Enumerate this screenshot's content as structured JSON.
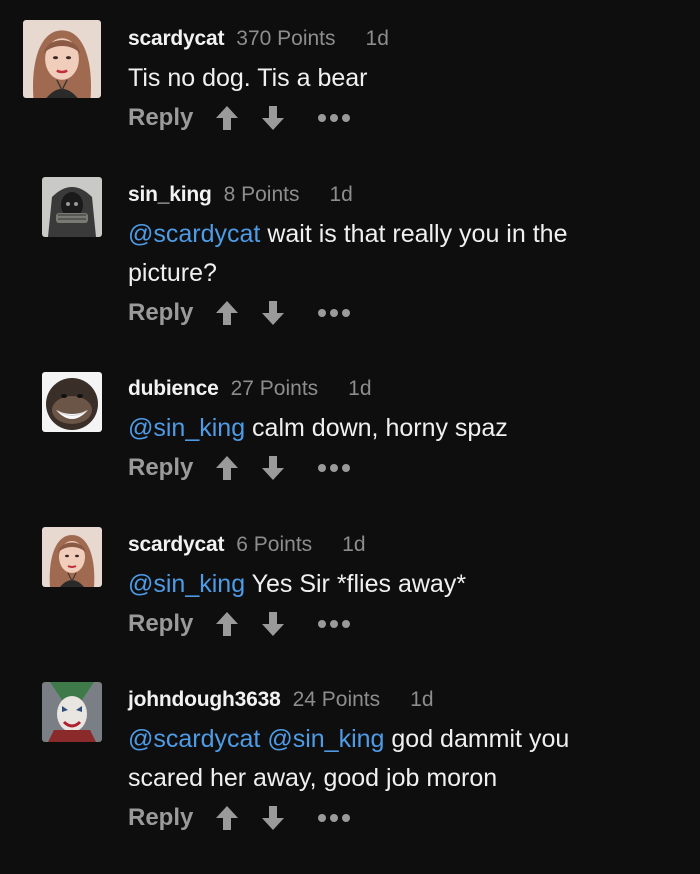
{
  "comments": [
    {
      "username": "scardycat",
      "points": "370 Points",
      "time": "1d",
      "text_segments": [
        {
          "text": "Tis no dog. Tis a bear",
          "mention": false
        }
      ],
      "reply_label": "Reply",
      "avatar": "woman-with-headphones-avatar"
    },
    {
      "username": "sin_king",
      "points": "8 Points",
      "time": "1d",
      "text_segments": [
        {
          "text": "@scardycat",
          "mention": true
        },
        {
          "text": " wait is that really you in the picture?",
          "mention": false
        }
      ],
      "reply_label": "Reply",
      "avatar": "hooded-reaper-avatar"
    },
    {
      "username": "dubience",
      "points": "27 Points",
      "time": "1d",
      "text_segments": [
        {
          "text": "@sin_king",
          "mention": true
        },
        {
          "text": " calm down, horny spaz",
          "mention": false
        }
      ],
      "reply_label": "Reply",
      "avatar": "grinning-chimp-avatar"
    },
    {
      "username": "scardycat",
      "points": "6 Points",
      "time": "1d",
      "text_segments": [
        {
          "text": "@sin_king",
          "mention": true
        },
        {
          "text": " Yes Sir *flies away*",
          "mention": false
        }
      ],
      "reply_label": "Reply",
      "avatar": "woman-with-headphones-avatar"
    },
    {
      "username": "johndough3638",
      "points": "24 Points",
      "time": "1d",
      "text_segments": [
        {
          "text": "@scardycat",
          "mention": true
        },
        {
          "text": " ",
          "mention": false
        },
        {
          "text": "@sin_king",
          "mention": true
        },
        {
          "text": " god dammit you scared her away, good job moron",
          "mention": false
        }
      ],
      "reply_label": "Reply",
      "avatar": "joker-face-avatar"
    }
  ],
  "icons": {
    "upvote": "arrow-up-icon",
    "downvote": "arrow-down-icon",
    "more": "more-options-icon"
  },
  "colors": {
    "background": "#0e0e0e",
    "mention": "#4e9be6",
    "muted": "#8d8d8d",
    "action": "#9a9a9a",
    "text": "#f0f0f0"
  }
}
